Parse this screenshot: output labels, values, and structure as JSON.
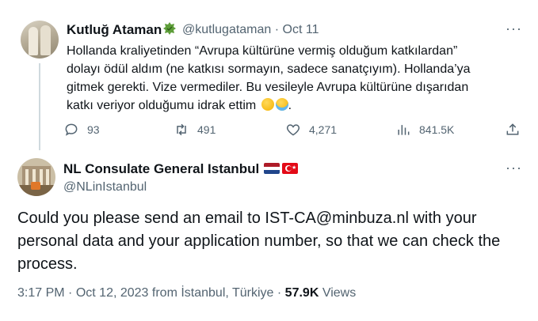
{
  "tweet1": {
    "display_name": "Kutluğ Ataman",
    "handle": "@kutlugataman",
    "separator": "·",
    "date": "Oct 11",
    "more": "···",
    "text_lines": [
      "Hollanda kraliyetinden “Avrupa kültürüne vermiş olduğum katkılardan”",
      "dolayı ödül aldım (ne katkısı sormayın, sadece sanatçıyım). Hollanda’ya",
      "gitmek gerekti. Vize vermediler. Bu vesileyle Avrupa kültürüne dışarıdan",
      "katkı veriyor olduğumu idrak ettim"
    ],
    "text_end": ".",
    "replies": "93",
    "reposts": "491",
    "likes": "4,271",
    "views": "841.5K",
    "icons": {
      "badge": "green-leaf-badge-icon",
      "reply": "reply-icon",
      "repost": "repost-icon",
      "like": "heart-icon",
      "views": "views-chart-icon",
      "share": "share-icon"
    },
    "emoji": [
      "shushing-face",
      "tears-of-joy-face"
    ]
  },
  "tweet2": {
    "display_name": "NL Consulate General Istanbul",
    "handle": "@NLinIstanbul",
    "more": "···",
    "flags": [
      "netherlands-flag",
      "turkey-flag"
    ],
    "text_lines": [
      "Could you please send an email to IST-CA@minbuza.nl with your",
      "personal data and your application number, so that we can check the",
      "process."
    ],
    "time": "3:17 PM",
    "separator": "·",
    "date": "Oct 12, 2023 from İstanbul, Türkiye",
    "views_count": "57.9K",
    "views_label": "Views"
  },
  "colors": {
    "text": "#0f1419",
    "secondary": "#536471",
    "thread_line": "#cfd9de",
    "nl_red": "#ae1c28",
    "nl_blue": "#21468b",
    "tr_red": "#e30a17"
  }
}
